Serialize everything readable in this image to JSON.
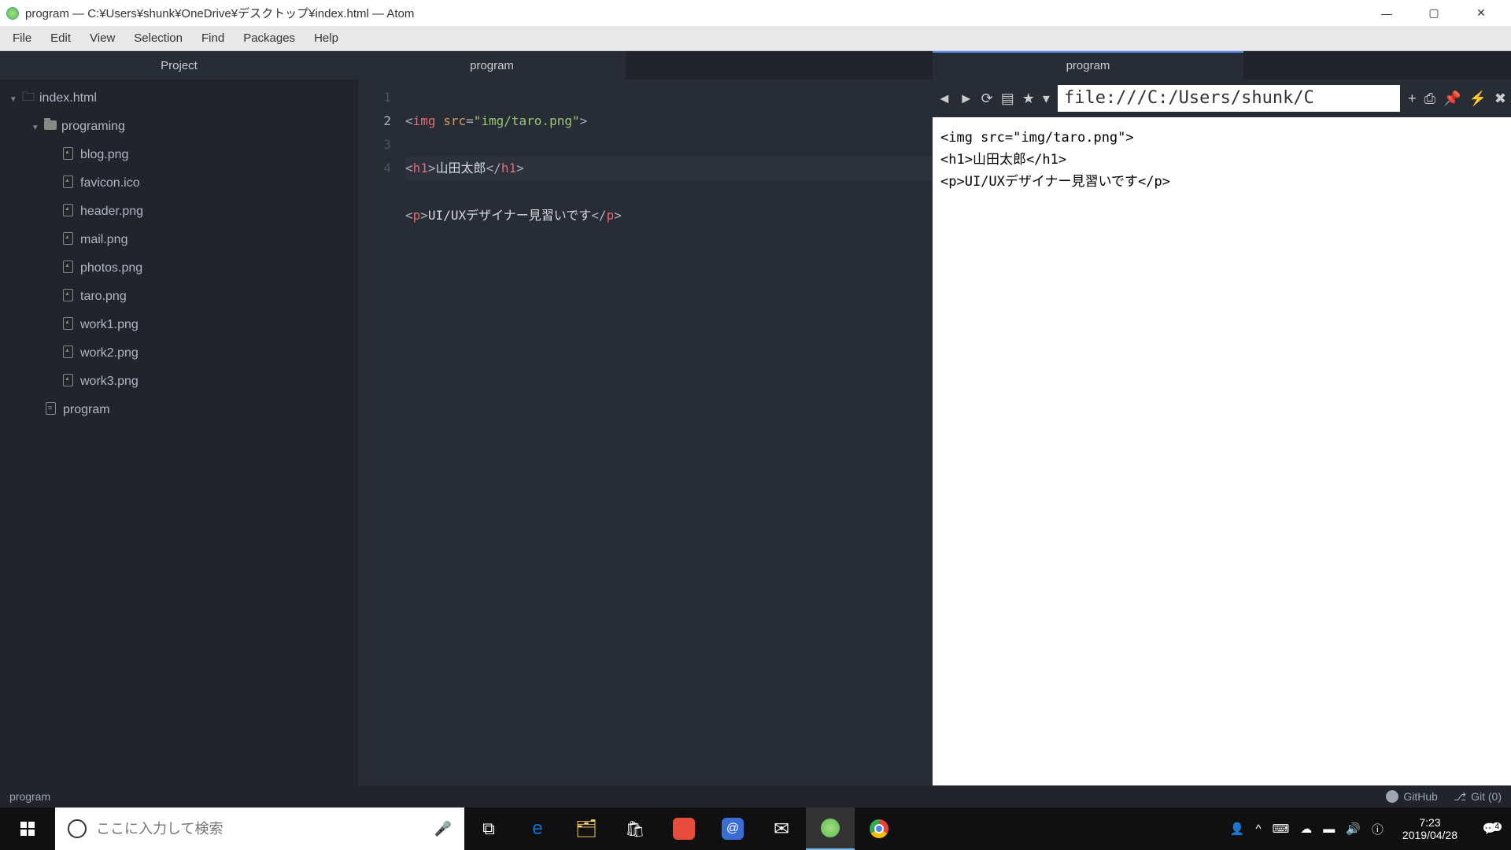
{
  "window": {
    "title": "program — C:¥Users¥shunk¥OneDrive¥デスクトップ¥index.html — Atom"
  },
  "menu": {
    "file": "File",
    "edit": "Edit",
    "view": "View",
    "selection": "Selection",
    "find": "Find",
    "packages": "Packages",
    "help": "Help"
  },
  "sidebar": {
    "title": "Project",
    "root": "index.html",
    "folder": "programing",
    "files": [
      "blog.png",
      "favicon.ico",
      "header.png",
      "mail.png",
      "photos.png",
      "taro.png",
      "work1.png",
      "work2.png",
      "work3.png"
    ],
    "program": "program"
  },
  "tabs": {
    "left": "program",
    "right": "program"
  },
  "editor": {
    "gutter": [
      "1",
      "2",
      "3",
      "4"
    ],
    "line1": {
      "b1": "<",
      "tag": "img",
      "sp": " ",
      "attr": "src",
      "eq": "=",
      "str": "\"img/taro.png\"",
      "b2": ">"
    },
    "line2": {
      "b1": "<",
      "tag": "h1",
      "b2": ">",
      "text": "山田太郎",
      "b3": "</",
      "tag2": "h1",
      "b4": ">"
    },
    "line3": {
      "b1": "<",
      "tag": "p",
      "b2": ">",
      "text": "UI/UXデザイナー見習いです",
      "b3": "</",
      "tag2": "p",
      "b4": ">"
    }
  },
  "preview": {
    "url": "file:///C:/Users/shunk/C",
    "body1": "<img src=\"img/taro.png\">",
    "body2": "<h1>山田太郎</h1>",
    "body3": "<p>UI/UXデザイナー見習いです</p>"
  },
  "status": {
    "left": "program",
    "github": "GitHub",
    "git": "Git (0)"
  },
  "taskbar": {
    "search_placeholder": "ここに入力して検索",
    "time": "7:23",
    "date": "2019/04/28",
    "notif_count": "4"
  }
}
